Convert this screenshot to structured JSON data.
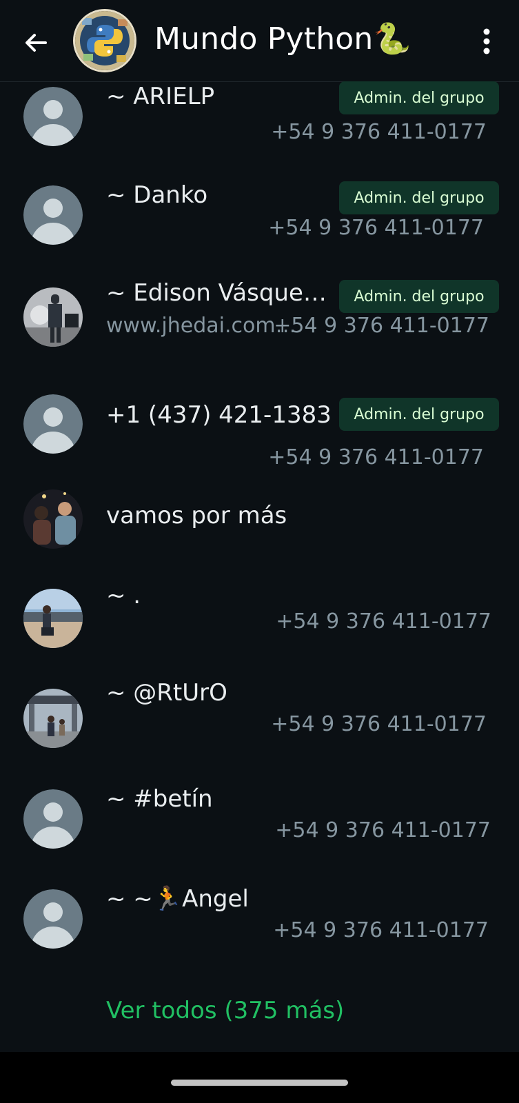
{
  "header": {
    "title": "Mundo Python🐍",
    "back_icon": "arrow-left-icon",
    "menu_icon": "more-vertical-icon"
  },
  "badge_label": "Admin. del grupo",
  "members": [
    {
      "name": "~ ARIELP",
      "phone": "+54 9 376 411-0177",
      "badge": "Admin. del grupo",
      "avatar": "default-avatar-icon"
    },
    {
      "name": "~ Danko",
      "phone": "+54 9 376 411-0177",
      "badge": "Admin. del grupo",
      "avatar": "default-avatar-icon"
    },
    {
      "name": "~ Edison Vásque…",
      "status": "www.jhedai.com…",
      "phone": "+54 9 376 411-0177",
      "badge": "Admin. del grupo",
      "avatar": "photo-avatar"
    },
    {
      "name": "+1 (437) 421-1383",
      "phone": "+54 9 376 411-0177",
      "badge": "Admin. del grupo",
      "avatar": "default-avatar-icon"
    },
    {
      "name": "vamos por más",
      "avatar": "photo-avatar"
    },
    {
      "name": "~ .",
      "phone": "+54 9 376 411-0177",
      "avatar": "photo-avatar"
    },
    {
      "name": "~ @RtUrO",
      "phone": "+54 9 376 411-0177",
      "avatar": "photo-avatar"
    },
    {
      "name": "~ #betín",
      "phone": "+54 9 376 411-0177",
      "avatar": "default-avatar-icon"
    },
    {
      "name": "~ ~🏃Angel",
      "phone": "+54 9 376 411-0177",
      "avatar": "default-avatar-icon"
    }
  ],
  "see_all": "Ver todos (375 más)",
  "colors": {
    "background": "#0b1014",
    "accent": "#21c063",
    "badge_bg": "#103529",
    "badge_text": "#d9fdd3",
    "secondary_text": "#8696a0"
  }
}
